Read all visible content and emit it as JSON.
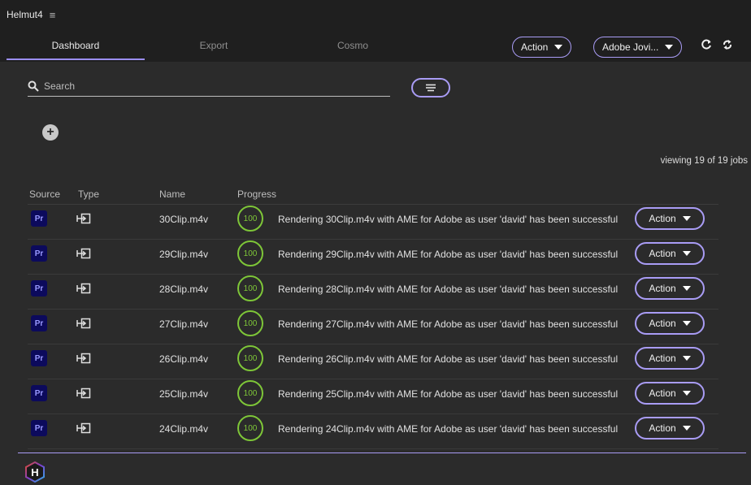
{
  "app": {
    "title": "Helmut4",
    "menu_icon": "hamburger-icon"
  },
  "nav": {
    "tabs": [
      {
        "label": "Dashboard",
        "active": true
      },
      {
        "label": "Export",
        "active": false
      },
      {
        "label": "Cosmo",
        "active": false
      }
    ],
    "action_dropdown": "Action",
    "project_dropdown": "Adobe Jovi...",
    "refresh_icon": "refresh-icon",
    "sync_icon": "sync-icon"
  },
  "search": {
    "placeholder": "Search",
    "value": ""
  },
  "filter_icon": "filter-lines-icon",
  "add_icon": "add-circle-icon",
  "viewing_text": "viewing 19 of 19 jobs",
  "table": {
    "headers": {
      "source": "Source",
      "type": "Type",
      "name": "Name",
      "progress": "Progress"
    },
    "rows": [
      {
        "source": "Pr",
        "name": "30Clip.m4v",
        "progress": "100",
        "message": "Rendering 30Clip.m4v with AME for Adobe as user 'david' has been successful",
        "action": "Action"
      },
      {
        "source": "Pr",
        "name": "29Clip.m4v",
        "progress": "100",
        "message": "Rendering 29Clip.m4v with AME for Adobe as user 'david' has been successful",
        "action": "Action"
      },
      {
        "source": "Pr",
        "name": "28Clip.m4v",
        "progress": "100",
        "message": "Rendering 28Clip.m4v with AME for Adobe as user 'david' has been successful",
        "action": "Action"
      },
      {
        "source": "Pr",
        "name": "27Clip.m4v",
        "progress": "100",
        "message": "Rendering 27Clip.m4v with AME for Adobe as user 'david' has been successful",
        "action": "Action"
      },
      {
        "source": "Pr",
        "name": "26Clip.m4v",
        "progress": "100",
        "message": "Rendering 26Clip.m4v with AME for Adobe as user 'david' has been successful",
        "action": "Action"
      },
      {
        "source": "Pr",
        "name": "25Clip.m4v",
        "progress": "100",
        "message": "Rendering 25Clip.m4v with AME for Adobe as user 'david' has been successful",
        "action": "Action"
      },
      {
        "source": "Pr",
        "name": "24Clip.m4v",
        "progress": "100",
        "message": "Rendering 24Clip.m4v with AME for Adobe as user 'david' has been successful",
        "action": "Action"
      }
    ]
  },
  "footer": {
    "logo_letter": "H"
  },
  "colors": {
    "accent": "#a99cf5",
    "success": "#7ec638",
    "background": "#2b2b2b",
    "bar": "#1f1f1f",
    "premiere": "#0c0a5c"
  }
}
